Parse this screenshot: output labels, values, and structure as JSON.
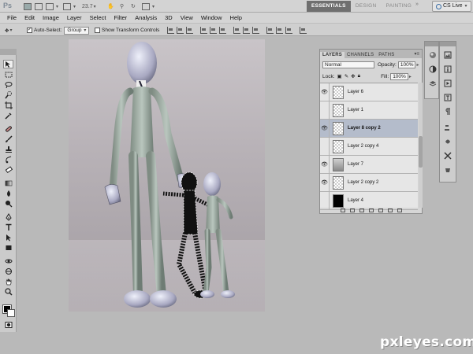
{
  "app": {
    "logo": "Ps",
    "zoom": "23.7",
    "workspaces": [
      "ESSENTIALS",
      "DESIGN",
      "PAINTING"
    ],
    "active_workspace": "ESSENTIALS",
    "more": "»",
    "cs_live": "CS Live"
  },
  "menu": [
    "File",
    "Edit",
    "Image",
    "Layer",
    "Select",
    "Filter",
    "Analysis",
    "3D",
    "View",
    "Window",
    "Help"
  ],
  "options": {
    "auto_select_label": "Auto-Select:",
    "auto_select_checked": true,
    "auto_select_value": "Group",
    "show_transform_label": "Show Transform Controls",
    "show_transform_checked": false
  },
  "layers_panel": {
    "tabs": [
      "LAYERS",
      "CHANNELS",
      "PATHS"
    ],
    "menu_icon": "▾≡",
    "blend_mode": "Normal",
    "opacity_label": "Opacity:",
    "opacity_value": "100%",
    "lock_label": "Lock:",
    "fill_label": "Fill:",
    "fill_value": "100%",
    "layers": [
      {
        "name": "Layer 6",
        "visible": true,
        "thumb": "transparent",
        "selected": false
      },
      {
        "name": "Layer 1",
        "visible": false,
        "thumb": "transparent",
        "selected": false
      },
      {
        "name": "Layer 8 copy 2",
        "visible": true,
        "thumb": "transparent",
        "selected": true
      },
      {
        "name": "Layer 2 copy 4",
        "visible": false,
        "thumb": "transparent",
        "selected": false
      },
      {
        "name": "Layer 7",
        "visible": true,
        "thumb": "gray",
        "selected": false
      },
      {
        "name": "Layer 2 copy 2",
        "visible": true,
        "thumb": "transparent",
        "selected": false
      },
      {
        "name": "Layer 4",
        "visible": false,
        "thumb": "black",
        "selected": false
      }
    ]
  },
  "colors": {
    "foreground": "#000000",
    "background": "#ffffff",
    "active_workspace_bg": "#6f6f6f",
    "selected_layer_bg": "#b4bccb"
  },
  "watermark": "pxleyes.com"
}
